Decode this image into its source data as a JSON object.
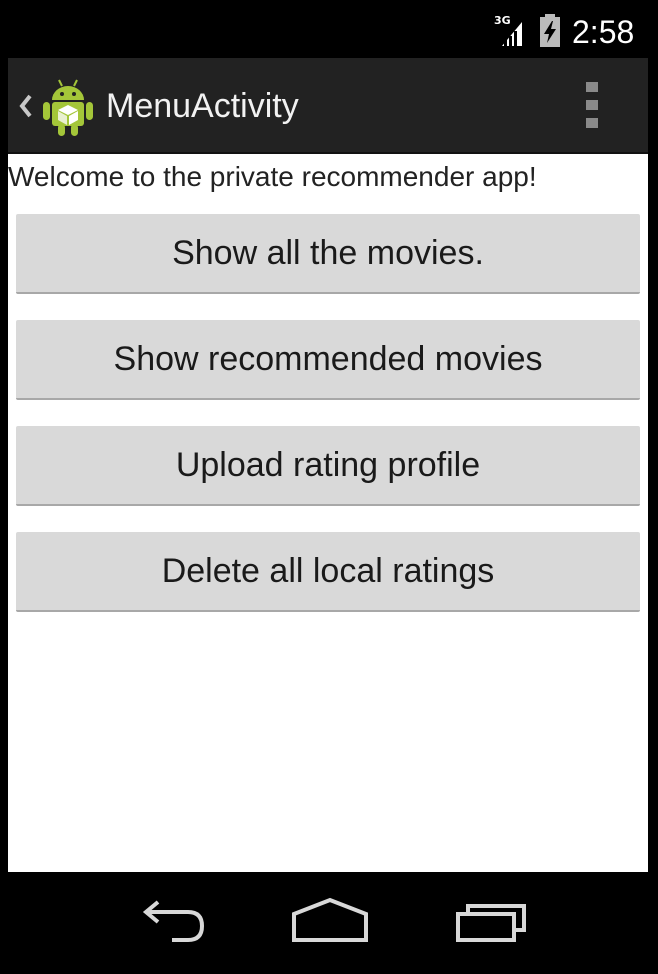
{
  "status_bar": {
    "network_label": "3G",
    "time": "2:58",
    "icons": [
      "signal-icon",
      "battery-charging-icon"
    ]
  },
  "action_bar": {
    "title": "MenuActivity",
    "icons": [
      "up-caret-icon",
      "android-app-icon",
      "overflow-menu-icon"
    ]
  },
  "content": {
    "welcome_text": "Welcome to the private recommender app!",
    "buttons": [
      {
        "label": "Show all the movies."
      },
      {
        "label": "Show recommended movies"
      },
      {
        "label": "Upload rating profile"
      },
      {
        "label": "Delete all local ratings"
      }
    ]
  },
  "nav_bar": {
    "icons": [
      "back-icon",
      "home-icon",
      "recent-apps-icon"
    ]
  },
  "colors": {
    "action_bar_bg": "#222222",
    "button_bg": "#d9d9d9",
    "android_green": "#a4c639"
  }
}
